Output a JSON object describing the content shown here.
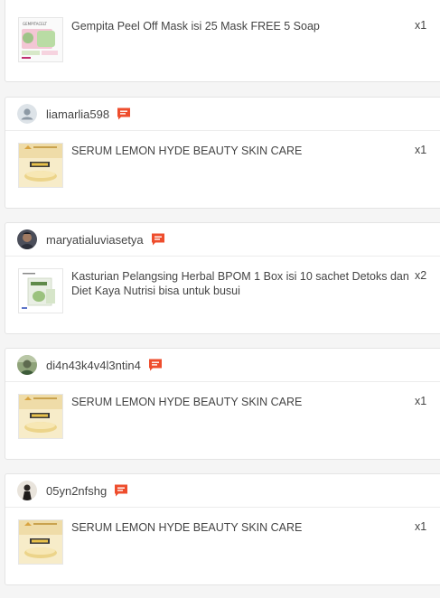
{
  "orders": [
    {
      "item": {
        "name": "Gempita Peel Off Mask isi 25 Mask FREE 5 Soap",
        "qty": "x1",
        "thumb_label": "GEMPITACELT"
      }
    },
    {
      "username": "liamarlia598",
      "item": {
        "name": "SERUM LEMON HYDE BEAUTY SKIN CARE",
        "qty": "x1"
      }
    },
    {
      "username": "maryatialuviasetya",
      "item": {
        "name": "Kasturian Pelangsing Herbal BPOM 1 Box isi 10 sachet Detoks dan Diet Kaya Nutrisi bisa untuk busui",
        "qty": "x2"
      }
    },
    {
      "username": "di4n43k4v4l3ntin4",
      "item": {
        "name": "SERUM LEMON HYDE BEAUTY SKIN CARE",
        "qty": "x1"
      }
    },
    {
      "username": "05yn2nfshg",
      "item": {
        "name": "SERUM LEMON HYDE BEAUTY SKIN CARE",
        "qty": "x1"
      }
    }
  ],
  "colors": {
    "chat_accent": "#ee4d2d",
    "card_border": "#e4e4e4",
    "page_bg": "#f5f5f5"
  },
  "icons": [
    "chat-icon",
    "default-avatar-icon"
  ]
}
